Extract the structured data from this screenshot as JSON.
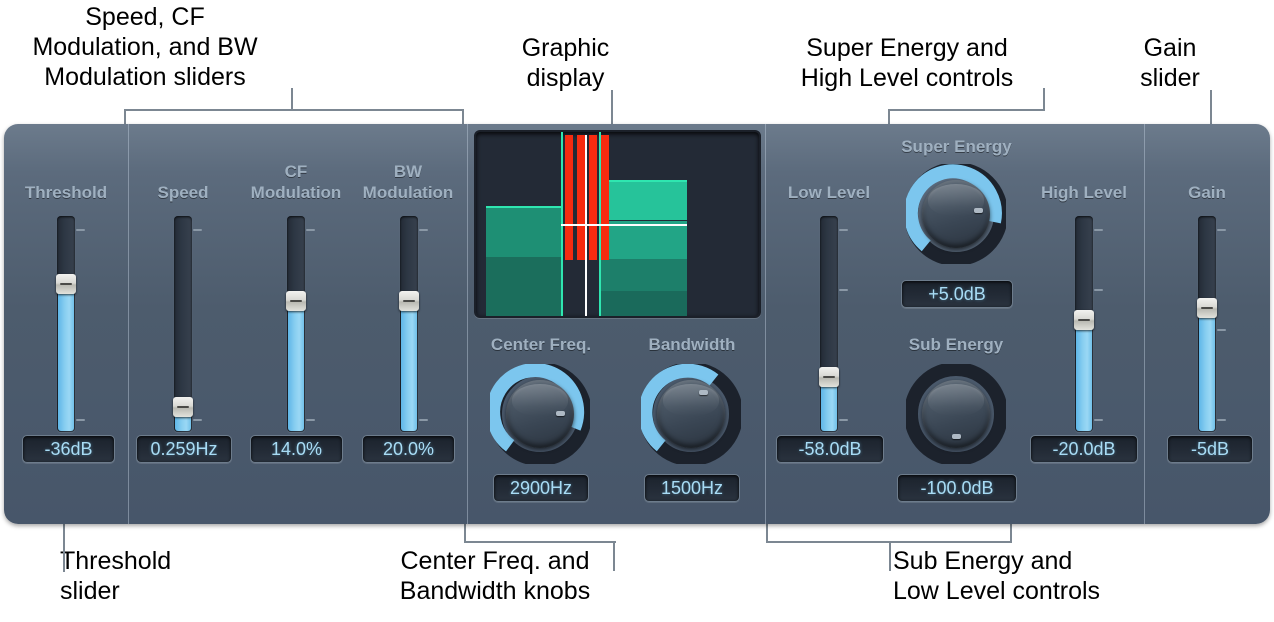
{
  "annotations": [
    {
      "id": "speed-cf-bw-callout",
      "text": "Speed, CF\nModulation, and BW\nModulation sliders"
    },
    {
      "id": "graphic-display-callout",
      "text": "Graphic\ndisplay"
    },
    {
      "id": "super-energy-high-level-callout",
      "text": "Super Energy and\nHigh Level controls"
    },
    {
      "id": "gain-slider-callout",
      "text": "Gain\nslider"
    },
    {
      "id": "threshold-slider-callout",
      "text": "Threshold\nslider"
    },
    {
      "id": "center-freq-bandwidth-callout",
      "text": "Center Freq. and\nBandwidth knobs"
    },
    {
      "id": "sub-energy-low-level-callout",
      "text": "Sub Energy and\nLow Level controls"
    }
  ],
  "plugin": {
    "sliders": {
      "threshold": {
        "label": "Threshold",
        "value": "-36dB",
        "fill_percent": 65
      },
      "speed": {
        "label": "Speed",
        "value": "0.259Hz",
        "fill_percent": 8
      },
      "cf_modulation": {
        "label": "CF\nModulation",
        "value": "14.0%",
        "fill_percent": 57
      },
      "bw_modulation": {
        "label": "BW\nModulation",
        "value": "20.0%",
        "fill_percent": 57
      },
      "low_level": {
        "label": "Low Level",
        "value": "-58.0dB",
        "fill_percent": 22
      },
      "high_level": {
        "label": "High Level",
        "value": "-20.0dB",
        "fill_percent": 48
      },
      "gain": {
        "label": "Gain",
        "value": "-5dB",
        "fill_percent": 54
      }
    },
    "knobs": {
      "center_freq": {
        "label": "Center Freq.",
        "value": "2900Hz",
        "arc_percent": 72
      },
      "bandwidth": {
        "label": "Bandwidth",
        "value": "1500Hz",
        "arc_percent": 56
      },
      "super_energy": {
        "label": "Super Energy",
        "value": "+5.0dB",
        "arc_percent": 78
      },
      "sub_energy": {
        "label": "Sub Energy",
        "value": "-100.0dB",
        "arc_percent": 0
      }
    },
    "display": {
      "name": "graphic-display",
      "low_band_level": 45,
      "mid_band_level": 100,
      "high_band_level": 70,
      "red_bar_count": 4
    },
    "colors": {
      "accent_blue": "#8ed0f0",
      "value_text": "#a8dcf5",
      "label_text": "#9fb0c0",
      "panel_top": "#6c7b8c",
      "panel_bottom": "#47566a",
      "display_green": "#2fe6b0",
      "display_red": "#f62b10",
      "knob_arc": "#7cc6ee"
    }
  }
}
